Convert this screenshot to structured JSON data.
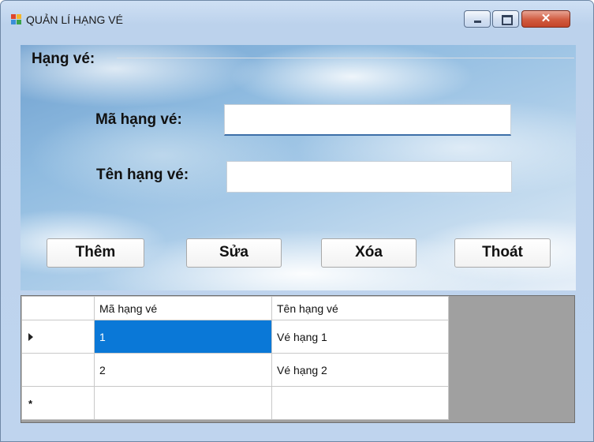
{
  "window": {
    "title": "QUẢN LÍ HẠNG VÉ",
    "icon": "app-form-icon",
    "controls": [
      "minimize-icon",
      "maximize-icon",
      "close-icon"
    ]
  },
  "form": {
    "group_label": "Hạng vé:",
    "ma_label": "Mã hạng vé:",
    "ma_value": "",
    "ten_label": "Tên hạng vé:",
    "ten_value": ""
  },
  "buttons": {
    "them": "Thêm",
    "sua": "Sửa",
    "xoa": "Xóa",
    "thoat": "Thoát"
  },
  "table": {
    "columns": [
      "Mã hạng vé",
      "Tên hạng vé"
    ],
    "rows": [
      {
        "ma": "1",
        "ten": "Vé hạng 1",
        "current": true
      },
      {
        "ma": "2",
        "ten": "Vé hạng 2",
        "current": false
      }
    ],
    "new_row_marker": "*"
  },
  "colors": {
    "selection": "#0a78d7",
    "close_button": "#d15b3f"
  }
}
